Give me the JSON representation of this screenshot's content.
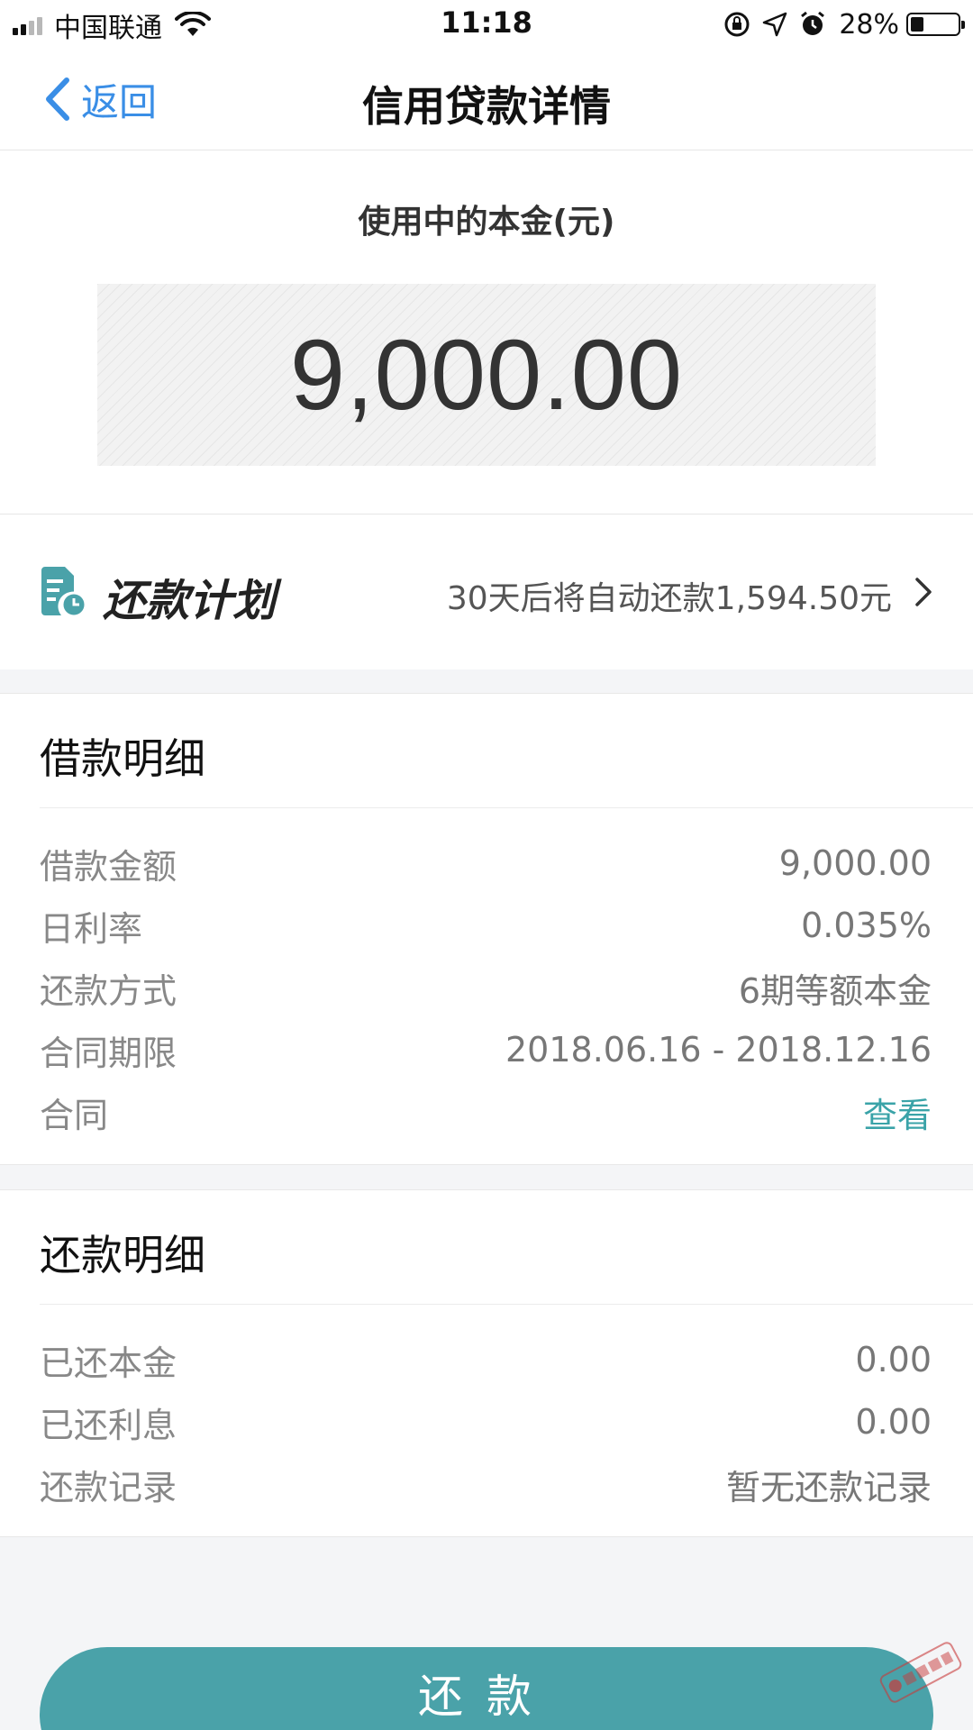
{
  "status_bar": {
    "carrier": "中国联通",
    "time": "11:18",
    "battery_percent": "28%",
    "battery_level": 0.28,
    "icons": [
      "signal-icon",
      "wifi-icon",
      "rotation-lock-icon",
      "location-icon",
      "alarm-icon",
      "battery-icon"
    ]
  },
  "nav": {
    "back_label": "返回",
    "title": "信用贷款详情"
  },
  "principal": {
    "label": "使用中的本金(元)",
    "amount": "9,000.00"
  },
  "plan": {
    "title": "还款计划",
    "description": "30天后将自动还款1,594.50元",
    "icon": "calendar-clock-icon"
  },
  "loan_details": {
    "title": "借款明细",
    "rows": [
      {
        "label": "借款金额",
        "value": "9,000.00"
      },
      {
        "label": "日利率",
        "value": "0.035%"
      },
      {
        "label": "还款方式",
        "value": "6期等额本金"
      },
      {
        "label": "合同期限",
        "value": "2018.06.16 - 2018.12.16"
      },
      {
        "label": "合同",
        "value": "查看"
      }
    ]
  },
  "repay_details": {
    "title": "还款明细",
    "rows": [
      {
        "label": "已还本金",
        "value": "0.00"
      },
      {
        "label": "已还利息",
        "value": "0.00"
      },
      {
        "label": "还款记录",
        "value": "暂无还款记录"
      }
    ]
  },
  "repay_button": {
    "label": "还款"
  },
  "colors": {
    "accent": "#4aa2a9",
    "link": "#3aa3a8",
    "back": "#3a8ee6",
    "background": "#f4f5f7"
  }
}
